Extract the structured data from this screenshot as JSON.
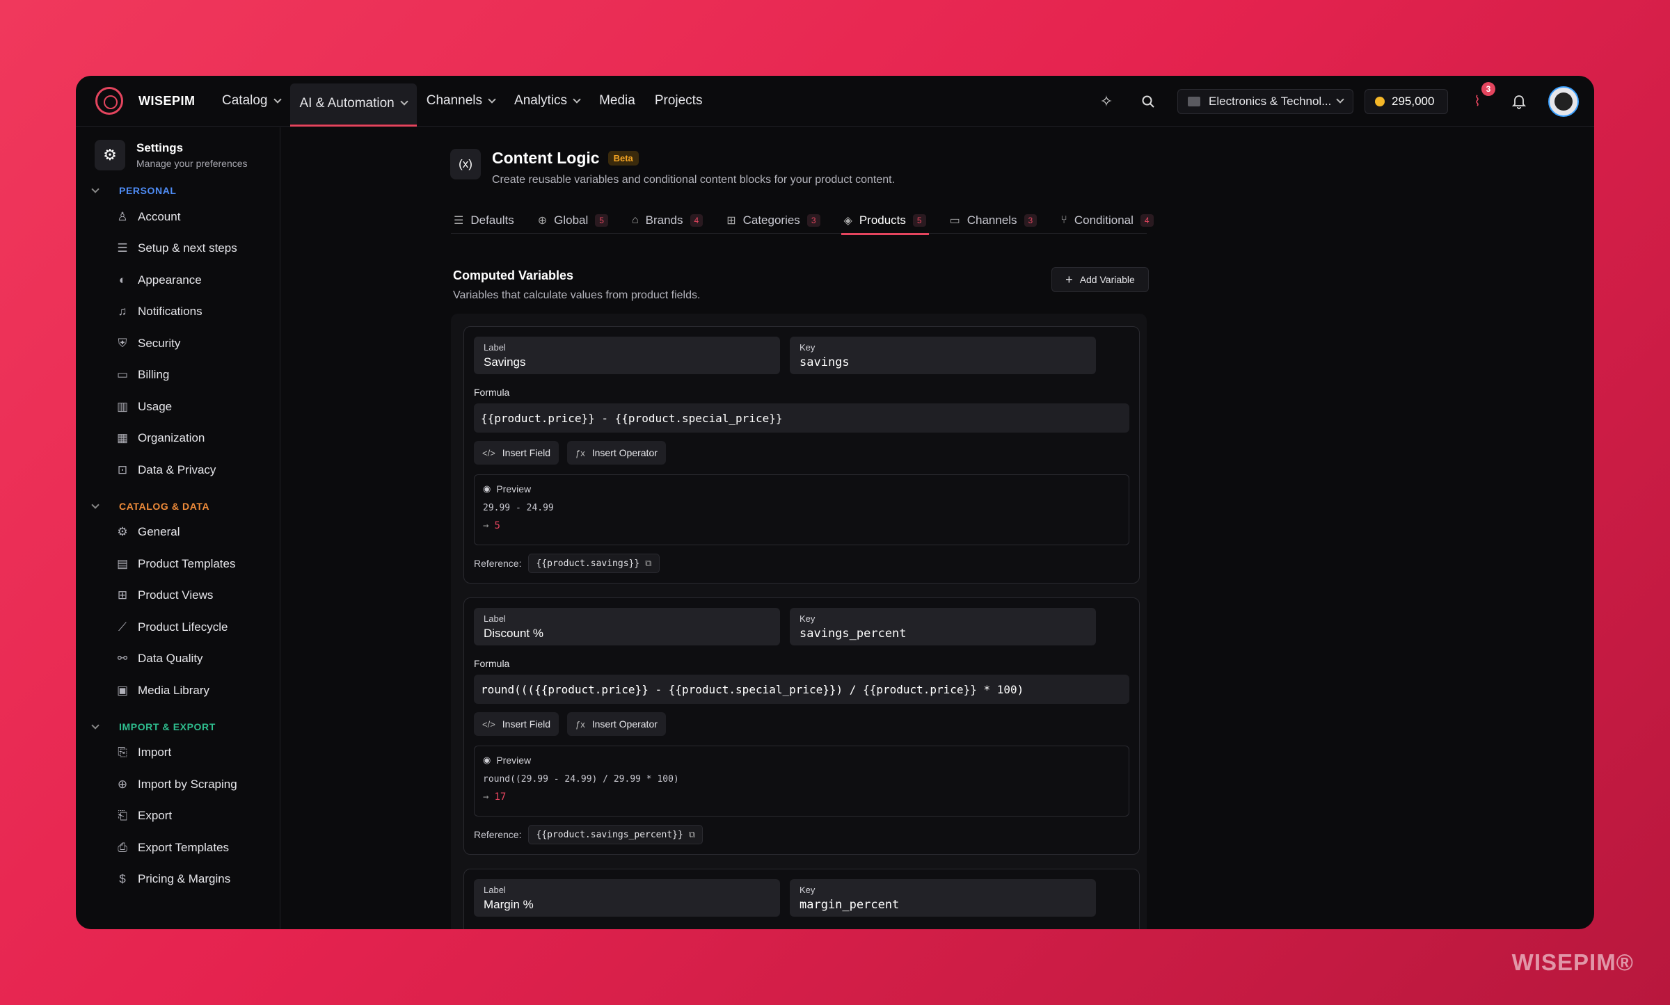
{
  "app": {
    "brand": "WISEPIM"
  },
  "nav": {
    "catalog": "Catalog",
    "ai": "AI & Automation",
    "channels": "Channels",
    "analytics": "Analytics",
    "media": "Media",
    "projects": "Projects"
  },
  "topbar": {
    "store": "Electronics & Technol...",
    "credits": "295,000",
    "alerts_count": "3"
  },
  "sidebar": {
    "title": "Settings",
    "subtitle": "Manage your preferences",
    "sections": [
      {
        "label": "PERSONAL",
        "color": "#4f8df7",
        "items": [
          "Account",
          "Setup & next steps",
          "Appearance",
          "Notifications",
          "Security",
          "Billing",
          "Usage",
          "Organization",
          "Data & Privacy"
        ]
      },
      {
        "label": "CATALOG & DATA",
        "color": "#f08c3a",
        "items": [
          "General",
          "Product Templates",
          "Product Views",
          "Product Lifecycle",
          "Data Quality",
          "Media Library"
        ]
      },
      {
        "label": "IMPORT & EXPORT",
        "color": "#2fbf8f",
        "items": [
          "Import",
          "Import by Scraping",
          "Export",
          "Export Templates",
          "Pricing & Margins"
        ]
      }
    ]
  },
  "page": {
    "icon_text": "(x)",
    "title": "Content Logic",
    "badge": "Beta",
    "subtitle": "Create reusable variables and conditional content blocks for your product content."
  },
  "tabs": [
    {
      "label": "Defaults",
      "count": ""
    },
    {
      "label": "Global",
      "count": "5"
    },
    {
      "label": "Brands",
      "count": "4"
    },
    {
      "label": "Categories",
      "count": "3"
    },
    {
      "label": "Products",
      "count": "5"
    },
    {
      "label": "Channels",
      "count": "3"
    },
    {
      "label": "Conditional",
      "count": "4"
    }
  ],
  "section": {
    "title": "Computed Variables",
    "subtitle": "Variables that calculate values from product fields.",
    "add_button": "Add Variable"
  },
  "common": {
    "label_caption": "Label",
    "key_caption": "Key",
    "formula_caption": "Formula",
    "insert_field": "Insert Field",
    "insert_operator": "Insert Operator",
    "preview": "Preview",
    "reference": "Reference:"
  },
  "variables": [
    {
      "label": "Savings",
      "key": "savings",
      "formula": "{{product.price}} - {{product.special_price}}",
      "preview_expr": "29.99 - 24.99",
      "preview_result": "5",
      "reference": "{{product.savings}}"
    },
    {
      "label": "Discount %",
      "key": "savings_percent",
      "formula": "round((({{product.price}} - {{product.special_price}}) / {{product.price}} * 100)",
      "preview_expr": "round((29.99 - 24.99) / 29.99 * 100)",
      "preview_result": "17",
      "reference": "{{product.savings_percent}}"
    },
    {
      "label": "Margin %",
      "key": "margin_percent"
    }
  ],
  "watermark": "WISEPIM®"
}
